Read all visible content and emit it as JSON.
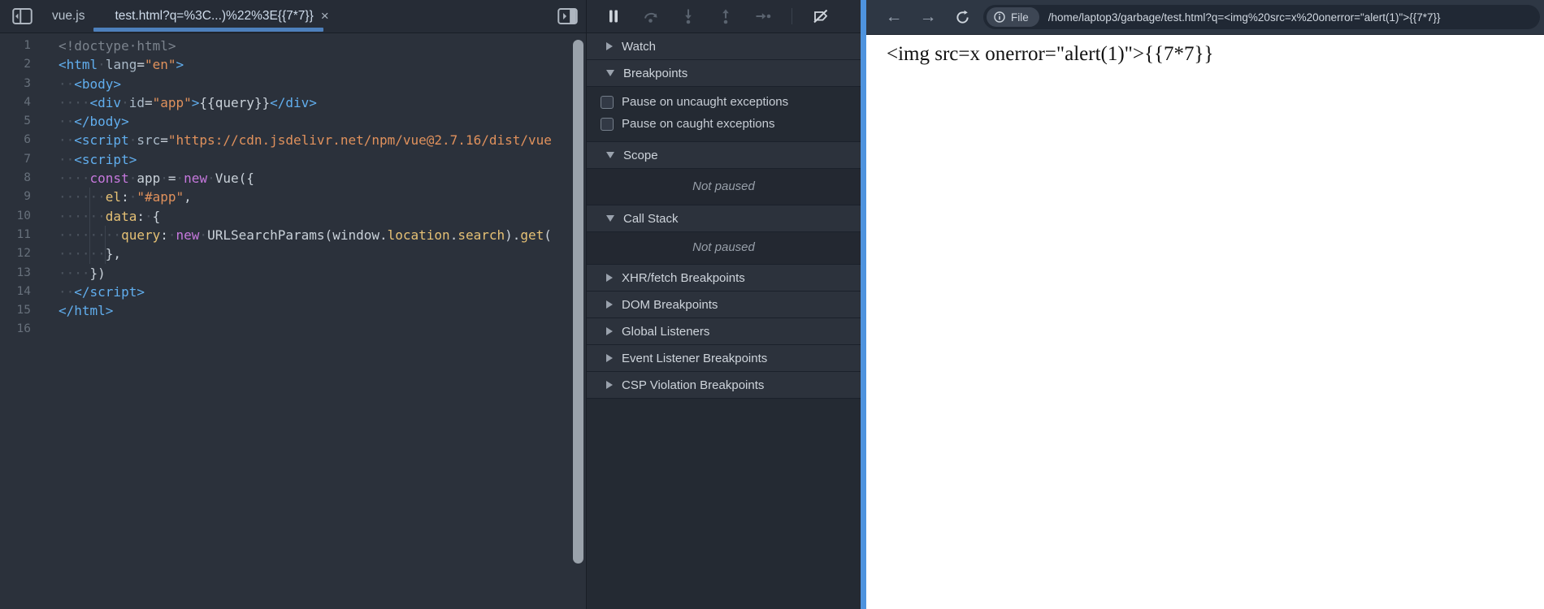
{
  "devtools": {
    "tabs": [
      {
        "label": "vue.js",
        "active": false
      },
      {
        "label": "test.html?q=%3C...)%22%3E{{7*7}}",
        "active": true,
        "close_glyph": "×"
      }
    ],
    "toolbar": {
      "icons": [
        "pause",
        "step-over",
        "step-into",
        "step-out",
        "step",
        "deactivate-breakpoints"
      ]
    },
    "editor": {
      "lines": [
        {
          "n": 1,
          "t": [
            [
              "cm",
              "<!doctype·html>"
            ]
          ]
        },
        {
          "n": 2,
          "t": [
            [
              "tag",
              "<html"
            ],
            [
              "ws",
              "·"
            ],
            [
              "attr",
              "lang"
            ],
            [
              "pl",
              "="
            ],
            [
              "str",
              "\"en\""
            ],
            [
              "tag",
              ">"
            ]
          ]
        },
        {
          "n": 3,
          "t": [
            [
              "ws",
              "··"
            ],
            [
              "tag",
              "<body>"
            ]
          ]
        },
        {
          "n": 4,
          "t": [
            [
              "ws",
              "····"
            ],
            [
              "tag",
              "<div"
            ],
            [
              "ws",
              "·"
            ],
            [
              "attr",
              "id"
            ],
            [
              "pl",
              "="
            ],
            [
              "str",
              "\"app\""
            ],
            [
              "tag",
              ">"
            ],
            [
              "pl",
              "{{query}}"
            ],
            [
              "tag",
              "</div>"
            ]
          ]
        },
        {
          "n": 5,
          "t": [
            [
              "ws",
              "··"
            ],
            [
              "tag",
              "</body>"
            ]
          ]
        },
        {
          "n": 6,
          "t": [
            [
              "ws",
              "··"
            ],
            [
              "tag",
              "<script"
            ],
            [
              "ws",
              "·"
            ],
            [
              "attr",
              "src"
            ],
            [
              "pl",
              "="
            ],
            [
              "str",
              "\"https://cdn.jsdelivr.net/npm/vue@2.7.16/dist/vue"
            ]
          ]
        },
        {
          "n": 7,
          "t": [
            [
              "ws",
              "··"
            ],
            [
              "tag",
              "<script>"
            ]
          ]
        },
        {
          "n": 8,
          "t": [
            [
              "ws",
              "····"
            ],
            [
              "kw",
              "const"
            ],
            [
              "ws",
              "·"
            ],
            [
              "pl",
              "app"
            ],
            [
              "ws",
              "·"
            ],
            [
              "pl",
              "="
            ],
            [
              "ws",
              "·"
            ],
            [
              "kw",
              "new"
            ],
            [
              "ws",
              "·"
            ],
            [
              "pl",
              "Vue({"
            ]
          ]
        },
        {
          "n": 9,
          "t": [
            [
              "ws",
              "······"
            ],
            [
              "prop",
              "el"
            ],
            [
              "pl",
              ":"
            ],
            [
              "ws",
              "·"
            ],
            [
              "str",
              "\"#app\""
            ],
            [
              "pl",
              ","
            ]
          ]
        },
        {
          "n": 10,
          "t": [
            [
              "ws",
              "······"
            ],
            [
              "prop",
              "data"
            ],
            [
              "pl",
              ":"
            ],
            [
              "ws",
              "·"
            ],
            [
              "pl",
              "{"
            ]
          ]
        },
        {
          "n": 11,
          "t": [
            [
              "ws",
              "········"
            ],
            [
              "prop",
              "query"
            ],
            [
              "pl",
              ":"
            ],
            [
              "ws",
              "·"
            ],
            [
              "kw",
              "new"
            ],
            [
              "ws",
              "·"
            ],
            [
              "pl",
              "URLSearchParams(window."
            ],
            [
              "prop",
              "location"
            ],
            [
              "pl",
              "."
            ],
            [
              "prop",
              "search"
            ],
            [
              "pl",
              ")."
            ],
            [
              "prop",
              "get"
            ],
            [
              "pl",
              "("
            ]
          ]
        },
        {
          "n": 12,
          "t": [
            [
              "ws",
              "······"
            ],
            [
              "pl",
              "},"
            ]
          ]
        },
        {
          "n": 13,
          "t": [
            [
              "ws",
              "····"
            ],
            [
              "pl",
              "})"
            ]
          ]
        },
        {
          "n": 14,
          "t": [
            [
              "ws",
              "··"
            ],
            [
              "tag",
              "</script>"
            ]
          ]
        },
        {
          "n": 15,
          "t": [
            [
              "tag",
              "</html>"
            ]
          ]
        },
        {
          "n": 16,
          "t": []
        }
      ]
    },
    "sidebar": {
      "sections": [
        {
          "label": "Watch",
          "state": "collapsed"
        },
        {
          "label": "Breakpoints",
          "state": "expanded",
          "items": [
            "Pause on uncaught exceptions",
            "Pause on caught exceptions"
          ]
        },
        {
          "label": "Scope",
          "state": "expanded",
          "content": "Not paused"
        },
        {
          "label": "Call Stack",
          "state": "expanded",
          "content": "Not paused"
        },
        {
          "label": "XHR/fetch Breakpoints",
          "state": "collapsed"
        },
        {
          "label": "DOM Breakpoints",
          "state": "collapsed"
        },
        {
          "label": "Global Listeners",
          "state": "collapsed"
        },
        {
          "label": "Event Listener Breakpoints",
          "state": "collapsed"
        },
        {
          "label": "CSP Violation Breakpoints",
          "state": "collapsed"
        }
      ]
    }
  },
  "browser": {
    "toolbar": {
      "back_glyph": "←",
      "forward_glyph": "→",
      "scheme_label": "File",
      "url": "/home/laptop3/garbage/test.html?q=<img%20src=x%20onerror=\"alert(1)\">{{7*7}}"
    },
    "page": {
      "text": "<img src=x onerror=\"alert(1)\">{{7*7}}"
    }
  },
  "colors": {
    "tab_underline": "#4d80bc",
    "window_separator": "#4e93de",
    "editor_bg": "#2b313b",
    "toolbar_bg": "#262c36",
    "browser_toolbar_bg": "#2e3744"
  }
}
